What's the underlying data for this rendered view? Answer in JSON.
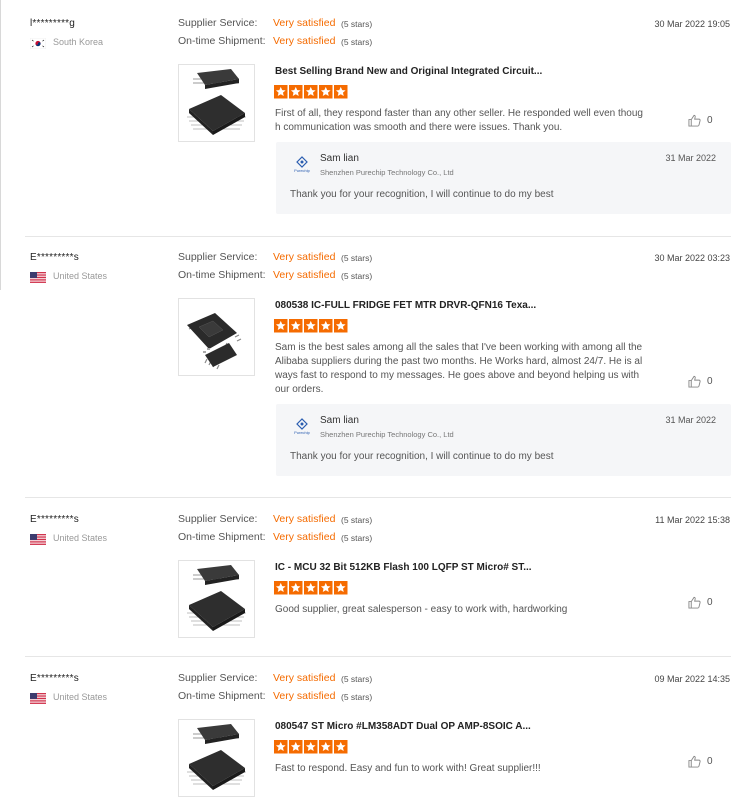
{
  "labels": {
    "supplier_service": "Supplier Service:",
    "on_time_shipment": "On-time Shipment:"
  },
  "colors": {
    "accent": "#f56b00",
    "reply_bg": "#f5f6f8",
    "divider": "#e6e6e6"
  },
  "reviews": [
    {
      "user": "l*********g",
      "country": "South Korea",
      "flag": "south-korea-flag",
      "date": "30 Mar 2022 19:05",
      "supplier_service": {
        "rating": "Very satisfied",
        "stars": "(5 stars)"
      },
      "on_time_shipment": {
        "rating": "Very satisfied",
        "stars": "(5 stars)"
      },
      "product_title": "Best Selling Brand New and Original Integrated Circuit...",
      "product_image": "qfp-chip-image",
      "product_rating": 5,
      "text": "First of all, they respond faster than any other seller. He responded well even though communication was smooth and there were issues. Thank you.",
      "likes": "0",
      "reply": {
        "name": "Sam lian",
        "company": "Shenzhen Purechip Technology Co., Ltd",
        "logo_text": "Purechip",
        "date": "31 Mar 2022",
        "text": "Thank you for your recognition, I will continue to do my best"
      }
    },
    {
      "user": "E*********s",
      "country": "United States",
      "flag": "united-states-flag",
      "date": "30 Mar 2022 03:23",
      "supplier_service": {
        "rating": "Very satisfied",
        "stars": "(5 stars)"
      },
      "on_time_shipment": {
        "rating": "Very satisfied",
        "stars": "(5 stars)"
      },
      "product_title": "080538 IC-FULL FRIDGE FET MTR DRVR-QFN16 Texa...",
      "product_image": "qfn-chip-image",
      "product_rating": 5,
      "text": "Sam is the best sales among all the sales that I've been working with among all the Alibaba suppliers during the past two months. He Works hard, almost 24/7.  He is always fast to respond to my messages.  He goes above and beyond helping us with our orders.",
      "likes": "0",
      "reply": {
        "name": "Sam lian",
        "company": "Shenzhen Purechip Technology Co., Ltd",
        "logo_text": "Purechip",
        "date": "31 Mar 2022",
        "text": "Thank you for your recognition, I will continue to do my best"
      }
    },
    {
      "user": "E*********s",
      "country": "United States",
      "flag": "united-states-flag",
      "date": "11 Mar 2022 15:38",
      "supplier_service": {
        "rating": "Very satisfied",
        "stars": "(5 stars)"
      },
      "on_time_shipment": {
        "rating": "Very satisfied",
        "stars": "(5 stars)"
      },
      "product_title": "IC - MCU 32 Bit 512KB Flash 100 LQFP ST Micro# ST...",
      "product_image": "qfp-chip-image",
      "product_rating": 5,
      "text": "Good supplier, great salesperson - easy to work with, hardworking",
      "likes": "0"
    },
    {
      "user": "E*********s",
      "country": "United States",
      "flag": "united-states-flag",
      "date": "09 Mar 2022 14:35",
      "supplier_service": {
        "rating": "Very satisfied",
        "stars": "(5 stars)"
      },
      "on_time_shipment": {
        "rating": "Very satisfied",
        "stars": "(5 stars)"
      },
      "product_title": "080547 ST Micro #LM358ADT Dual OP AMP-8SOIC A...",
      "product_image": "qfp-chip-image",
      "product_rating": 5,
      "text": "Fast to respond.  Easy and fun to work with!  Great supplier!!!",
      "likes": "0"
    }
  ]
}
